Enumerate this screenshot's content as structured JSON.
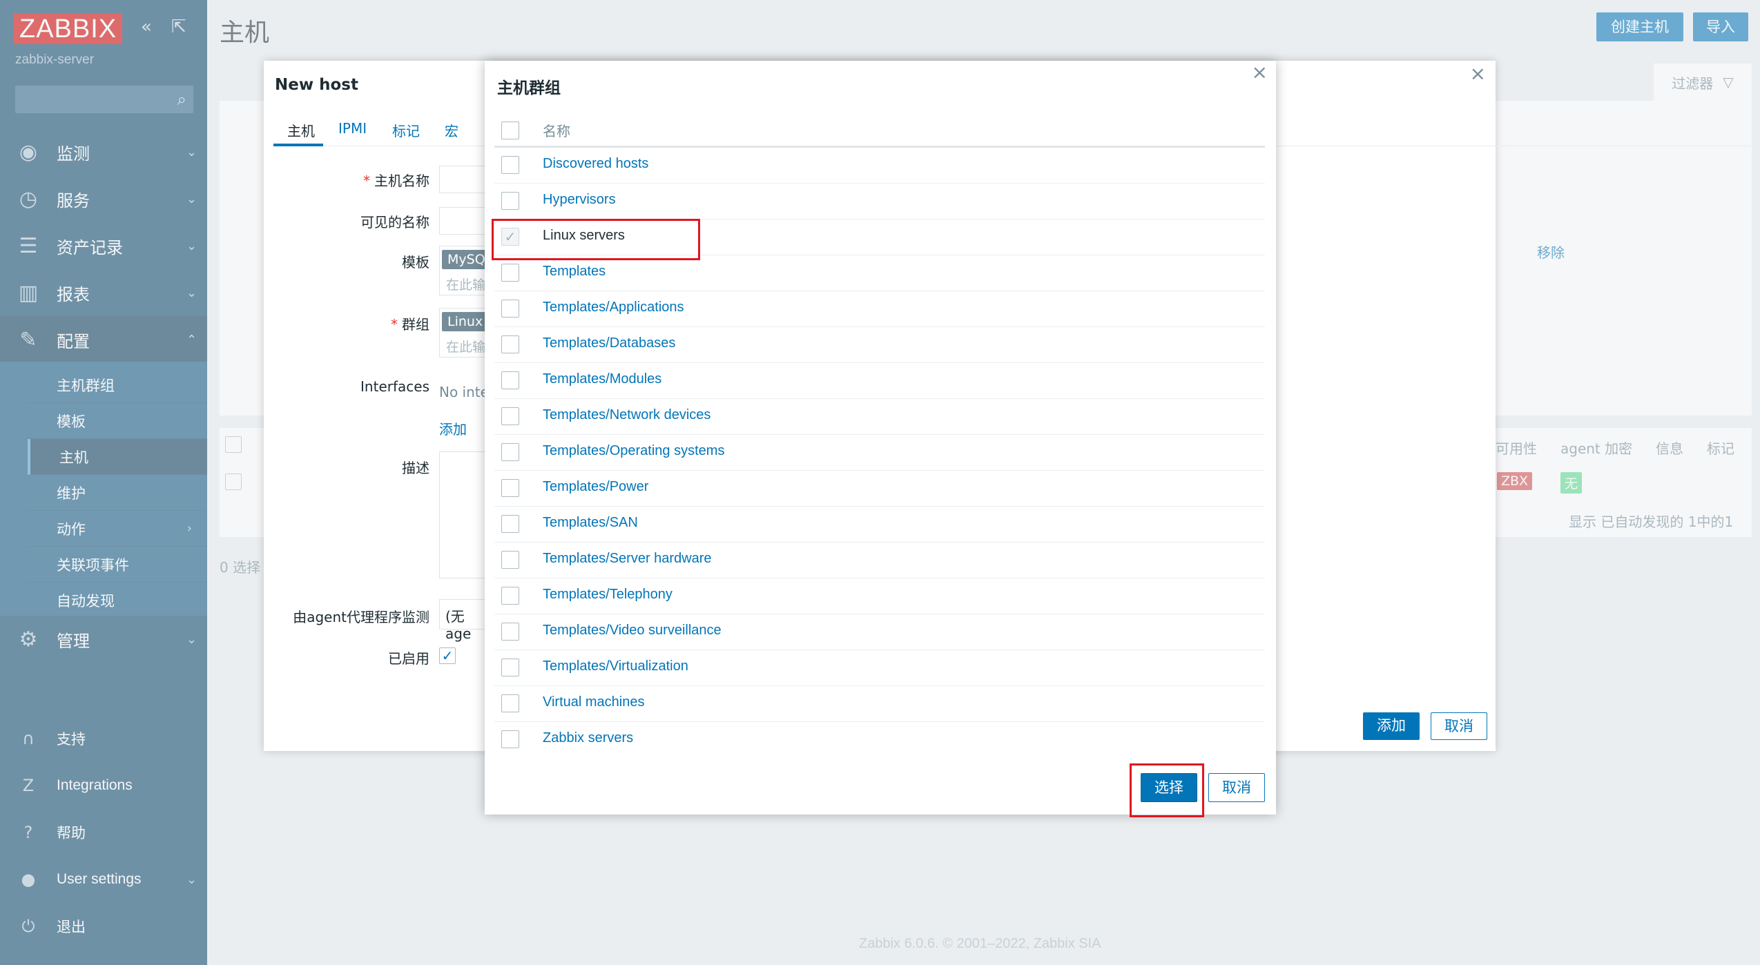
{
  "sidebar": {
    "logo": "ZABBIX",
    "server": "zabbix-server",
    "menu": [
      {
        "label": "监测",
        "icon": "eye-icon"
      },
      {
        "label": "服务",
        "icon": "clock-icon"
      },
      {
        "label": "资产记录",
        "icon": "list-icon"
      },
      {
        "label": "报表",
        "icon": "bar-chart-icon"
      },
      {
        "label": "配置",
        "icon": "wrench-icon"
      },
      {
        "label": "管理",
        "icon": "gear-icon"
      }
    ],
    "submenu": [
      "主机群组",
      "模板",
      "主机",
      "维护",
      "动作",
      "关联项事件",
      "自动发现"
    ],
    "footer": [
      {
        "label": "支持",
        "icon": "headset-icon"
      },
      {
        "label": "Integrations",
        "icon": "zabbix-icon"
      },
      {
        "label": "帮助",
        "icon": "question-icon"
      },
      {
        "label": "User settings",
        "icon": "user-icon"
      },
      {
        "label": "退出",
        "icon": "power-icon"
      }
    ]
  },
  "page": {
    "title": "主机",
    "create_host": "创建主机",
    "import": "导入",
    "filter": "过滤器",
    "remove": "移除",
    "columns": [
      "可用性",
      "agent 加密",
      "信息",
      "标记"
    ],
    "tag_zbx": "ZBX",
    "tag_none": "无",
    "shown": "显示 已自动发现的 1中的1",
    "selected": "0 选择",
    "footer": "Zabbix 6.0.6. © 2001–2022, Zabbix SIA"
  },
  "host_dialog": {
    "title": "New host",
    "tabs": [
      "主机",
      "IPMI",
      "标记",
      "宏"
    ],
    "labels": {
      "host_name": "主机名称",
      "visible_name": "可见的名称",
      "templates": "模板",
      "groups": "群组",
      "interfaces": "Interfaces",
      "description": "描述",
      "proxy": "由agent代理程序监测",
      "enabled": "已启用"
    },
    "template_chip": "MySQ",
    "group_chip": "Linux",
    "placeholder": "在此输",
    "interfaces_text": "No inte",
    "add_link": "添加",
    "proxy_value": "(无age",
    "add_button": "添加",
    "cancel_button": "取消"
  },
  "group_dialog": {
    "title": "主机群组",
    "column": "名称",
    "groups": [
      "Discovered hosts",
      "Hypervisors",
      "Linux servers",
      "Templates",
      "Templates/Applications",
      "Templates/Databases",
      "Templates/Modules",
      "Templates/Network devices",
      "Templates/Operating systems",
      "Templates/Power",
      "Templates/SAN",
      "Templates/Server hardware",
      "Templates/Telephony",
      "Templates/Video surveillance",
      "Templates/Virtualization",
      "Virtual machines",
      "Zabbix servers"
    ],
    "selected_group": "Linux servers",
    "select_button": "选择",
    "cancel_button": "取消"
  },
  "colors": {
    "sidebar": "#0a466a",
    "accent": "#0275b8",
    "highlight": "#e0161e",
    "logo": "#d40000"
  }
}
